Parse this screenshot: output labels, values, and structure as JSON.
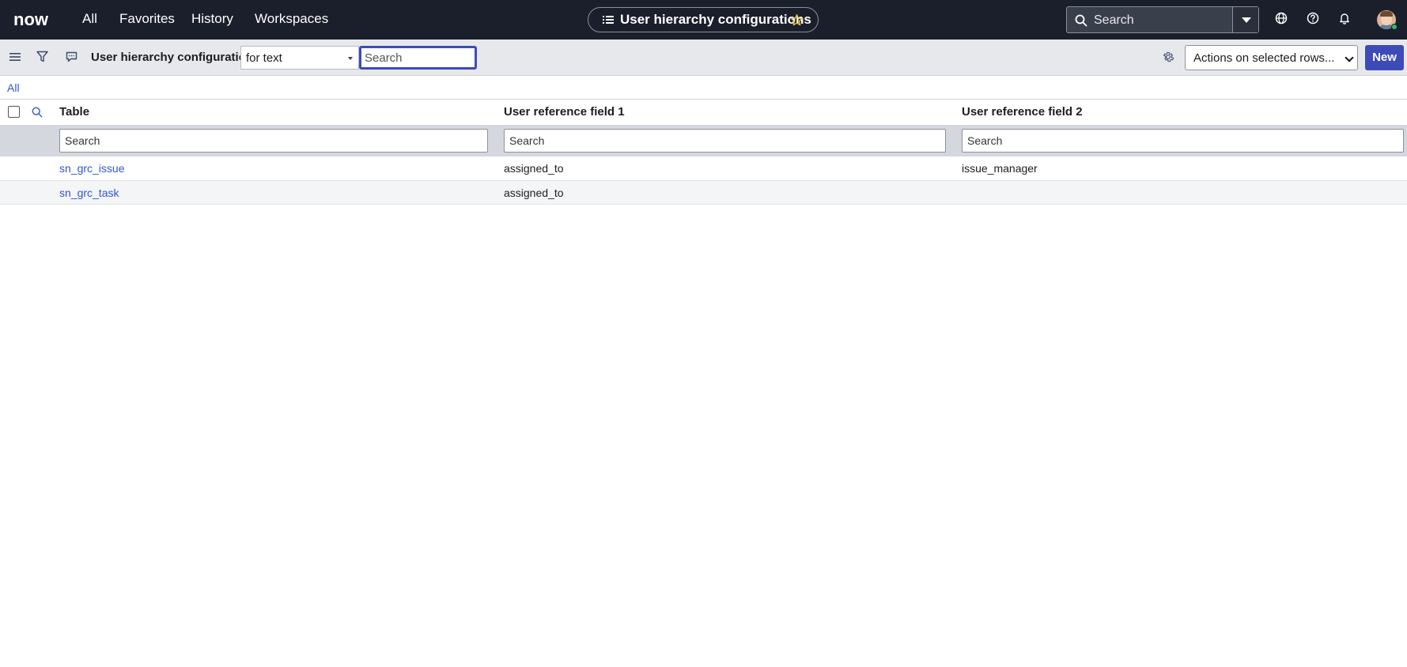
{
  "topnav": {
    "logo_text": "now",
    "links": [
      "All",
      "Favorites",
      "History",
      "Workspaces"
    ],
    "page_pill_title": "User hierarchy configurations",
    "global_search_placeholder": "Search"
  },
  "toolbar": {
    "list_title": "User hierarchy configurations",
    "search_scope": "for text",
    "search_placeholder": "Search",
    "actions_label": "Actions on selected rows...",
    "new_label": "New"
  },
  "breadcrumb": "All",
  "table": {
    "columns": [
      "Table",
      "User reference field 1",
      "User reference field 2"
    ],
    "column_search_placeholder": "Search",
    "rows": [
      [
        "sn_grc_issue",
        "assigned_to",
        "issue_manager"
      ],
      [
        "sn_grc_task",
        "assigned_to",
        ""
      ]
    ]
  },
  "colors": {
    "nav_bg": "#1b1f2b",
    "accent": "#3d4bb8",
    "link": "#2f55d4",
    "toolbar_bg": "#e6e8ec",
    "logo_green": "#62d84e"
  }
}
